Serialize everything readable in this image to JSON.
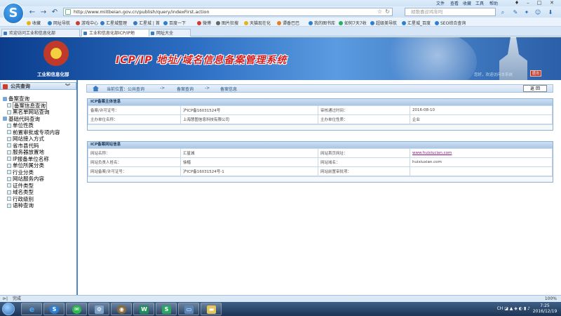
{
  "browser": {
    "menu": [
      "文件",
      "查看",
      "收藏",
      "工具",
      "帮助"
    ],
    "address": "http://www.miitbeian.gov.cn/publish/query/indexFirst.action",
    "search_placeholder": "胡歌喜迎鸡年吗",
    "favorites": [
      "收藏",
      "网址导航",
      "游戏中心",
      "汇星城整理",
      "汇星城 | 首",
      "百度一下",
      "微博",
      "图片狂搜",
      "天猫现在化",
      "谭香巴巴",
      "我的图书库",
      "如何7天7收",
      "超级美导航",
      "汇星城_百度",
      "SEO综合查询"
    ],
    "tabs": [
      "欢迎访问工业和信息化部",
      "工业和信息化部ICP/IP地",
      "网址大全"
    ],
    "status": "完成",
    "zoom": "100%"
  },
  "header": {
    "ministry": "工业和信息化部",
    "title": "ICP/IP 地址/域名信息备案管理系统",
    "welcome": "您好，欢迎访问本系统",
    "exit": "退出"
  },
  "sidebar": {
    "title": "公共查询",
    "groups": [
      {
        "label": "备案查询",
        "items": [
          "备案信息查询",
          "黑名单网站查询"
        ]
      },
      {
        "label": "基础代码查询",
        "items": [
          "单位性质",
          "前置审批或专项内容",
          "网站接入方式",
          "省市县代码",
          "服务器放置地",
          "IP报备单位名称",
          "单位所属分类",
          "行业分类",
          "网站服务内容",
          "证件类型",
          "域名类型",
          "行政级别",
          "语种查询"
        ]
      }
    ]
  },
  "breadcrumb": {
    "location": "当前位置：公共查询",
    "sep": "->",
    "level2": "备案查询",
    "level3": "备案信息",
    "back": "返 回"
  },
  "subject_panel": {
    "title": "ICP备案主体信息",
    "rows": [
      {
        "l1": "备案/许可证号：",
        "v1": "沪ICP备16031524号",
        "l2": "审核通过时间：",
        "v2": "2016-08-10"
      },
      {
        "l1": "主办单位名称：",
        "v1": "上海慧图信息科技有限公司",
        "l2": "主办单位性质：",
        "v2": "企业"
      }
    ]
  },
  "site_panel": {
    "title": "ICP备案网站信息",
    "rows": [
      {
        "l1": "网站名称：",
        "v1": "汇星城",
        "l2": "网站首页网址：",
        "v2": "www.huixiucian.com"
      },
      {
        "l1": "网站负责人姓名：",
        "v1": "徐楷",
        "l2": "网站域名：",
        "v2": "huixiuxian.com"
      },
      {
        "l1": "网站备案/许可证号：",
        "v1": "沪ICP备16031524号-1",
        "l2": "网站前置审批项：",
        "v2": ""
      }
    ]
  },
  "taskbar": {
    "lang": "CH",
    "time": "7:25",
    "date": "2016/12/19"
  },
  "colors": {
    "header_blue": "#2d6fc4",
    "title_red": "#d62020",
    "sidebar_border": "#4d86c6"
  }
}
